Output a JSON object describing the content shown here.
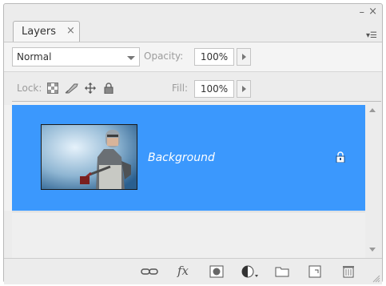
{
  "panel": {
    "tab_label": "Layers",
    "tab_close_glyph": "×",
    "window_min_glyph": "–",
    "window_close_glyph": "×",
    "panel_menu_glyph": "▾☰"
  },
  "blend": {
    "mode_value": "Normal",
    "opacity_label": "Opacity:",
    "opacity_value": "100%"
  },
  "lock_row": {
    "lock_label": "Lock:",
    "fill_label": "Fill:",
    "fill_value": "100%"
  },
  "layers": [
    {
      "name": "Background",
      "visible": true,
      "locked": true,
      "selected": true
    }
  ],
  "bottom_toolbar": {
    "icons": [
      "link-layers-icon",
      "fx-icon",
      "add-mask-icon",
      "adjustment-layer-icon",
      "new-group-icon",
      "new-layer-icon",
      "trash-icon"
    ],
    "fx_text": "fx"
  },
  "colors": {
    "selection": "#3b98fd",
    "panel_bg": "#ececec"
  }
}
